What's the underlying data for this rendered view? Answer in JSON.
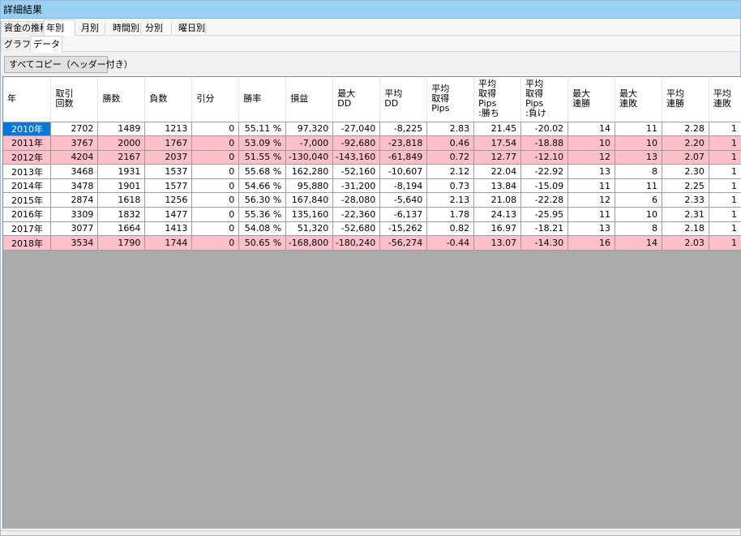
{
  "window": {
    "title": "詳細結果"
  },
  "top_tabs": [
    "資金の推移",
    "年別",
    "月別",
    "時間別",
    "分別",
    "曜日別"
  ],
  "active_top_tab": "年別",
  "sub_tabs": [
    "グラフ",
    "データ"
  ],
  "active_sub_tab": "データ",
  "copy_button": {
    "label": "すべてコピー（ヘッダー付き）"
  },
  "table": {
    "columns": [
      "年",
      "取引\n回数",
      "勝数",
      "負数",
      "引分",
      "勝率",
      "損益",
      "最大\nDD",
      "平均\nDD",
      "平均\n取得\nPips",
      "平均\n取得\nPips\n:勝ち",
      "平均\n取得\nPips\n:負け",
      "最大\n連勝",
      "最大\n連敗",
      "平均\n連勝",
      "平均\n連敗"
    ],
    "rows": [
      {
        "negative": false,
        "cells": [
          "2010年",
          "2702",
          "1489",
          "1213",
          "0",
          "55.11 %",
          "97,320",
          "-27,040",
          "-8,225",
          "2.83",
          "21.45",
          "-20.02",
          "14",
          "11",
          "2.28",
          "1"
        ]
      },
      {
        "negative": true,
        "cells": [
          "2011年",
          "3767",
          "2000",
          "1767",
          "0",
          "53.09 %",
          "-7,000",
          "-92,680",
          "-23,818",
          "0.46",
          "17.54",
          "-18.88",
          "10",
          "10",
          "2.20",
          "1"
        ]
      },
      {
        "negative": true,
        "cells": [
          "2012年",
          "4204",
          "2167",
          "2037",
          "0",
          "51.55 %",
          "-130,040",
          "-143,160",
          "-61,849",
          "0.72",
          "12.77",
          "-12.10",
          "12",
          "13",
          "2.07",
          "1"
        ]
      },
      {
        "negative": false,
        "cells": [
          "2013年",
          "3468",
          "1931",
          "1537",
          "0",
          "55.68 %",
          "162,280",
          "-52,160",
          "-10,607",
          "2.12",
          "22.04",
          "-22.92",
          "13",
          "8",
          "2.30",
          "1"
        ]
      },
      {
        "negative": false,
        "cells": [
          "2014年",
          "3478",
          "1901",
          "1577",
          "0",
          "54.66 %",
          "95,880",
          "-31,200",
          "-8,194",
          "0.73",
          "13.84",
          "-15.09",
          "11",
          "11",
          "2.25",
          "1"
        ]
      },
      {
        "negative": false,
        "cells": [
          "2015年",
          "2874",
          "1618",
          "1256",
          "0",
          "56.30 %",
          "167,840",
          "-28,080",
          "-5,640",
          "2.13",
          "21.08",
          "-22.28",
          "12",
          "6",
          "2.33",
          "1"
        ]
      },
      {
        "negative": false,
        "cells": [
          "2016年",
          "3309",
          "1832",
          "1477",
          "0",
          "55.36 %",
          "135,160",
          "-22,360",
          "-6,137",
          "1.78",
          "24.13",
          "-25.95",
          "11",
          "10",
          "2.31",
          "1"
        ]
      },
      {
        "negative": false,
        "cells": [
          "2017年",
          "3077",
          "1664",
          "1413",
          "0",
          "54.08 %",
          "51,320",
          "-52,680",
          "-15,262",
          "0.82",
          "16.97",
          "-18.21",
          "13",
          "8",
          "2.18",
          "1"
        ]
      },
      {
        "negative": true,
        "cells": [
          "2018年",
          "3534",
          "1790",
          "1744",
          "0",
          "50.65 %",
          "-168,800",
          "-180,240",
          "-56,274",
          "-0.44",
          "13.07",
          "-14.30",
          "16",
          "14",
          "2.03",
          "1"
        ]
      }
    ]
  },
  "colors": {
    "title_bar": "#99d1f4",
    "negative_row": "#ffc0cb",
    "selection": "#0078d7",
    "empty_area": "#ababab"
  }
}
